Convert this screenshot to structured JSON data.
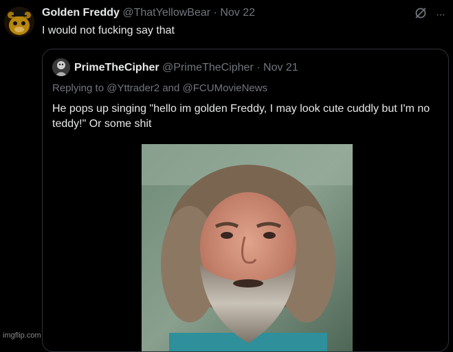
{
  "tweet": {
    "author_name": "Golden Freddy",
    "author_handle": "@ThatYellowBear",
    "date": "Nov 22",
    "separator": "·",
    "text": "I would not fucking say that",
    "avatar_icon": "golden-freddy-avatar-icon",
    "actions": [
      "grok-icon",
      "more-icon"
    ],
    "more_label": "···"
  },
  "quote": {
    "author_name": "PrimeTheCipher",
    "author_handle": "@PrimeTheCipher",
    "date": "Nov 21",
    "separator": "·",
    "replying_prefix": "Replying to",
    "replying_user1": "@Yttrader2",
    "replying_and": "and",
    "replying_user2": "@FCUMovieNews",
    "text": "He pops up singing \"hello im golden Freddy, I may look cute cuddly but I'm no teddy!\" Or some shit",
    "image": "bearded-man-photo"
  },
  "watermark": "imgflip.com",
  "colors": {
    "background": "#000000",
    "text": "#e7e9ea",
    "muted": "#71767b",
    "border": "#2f3336"
  }
}
